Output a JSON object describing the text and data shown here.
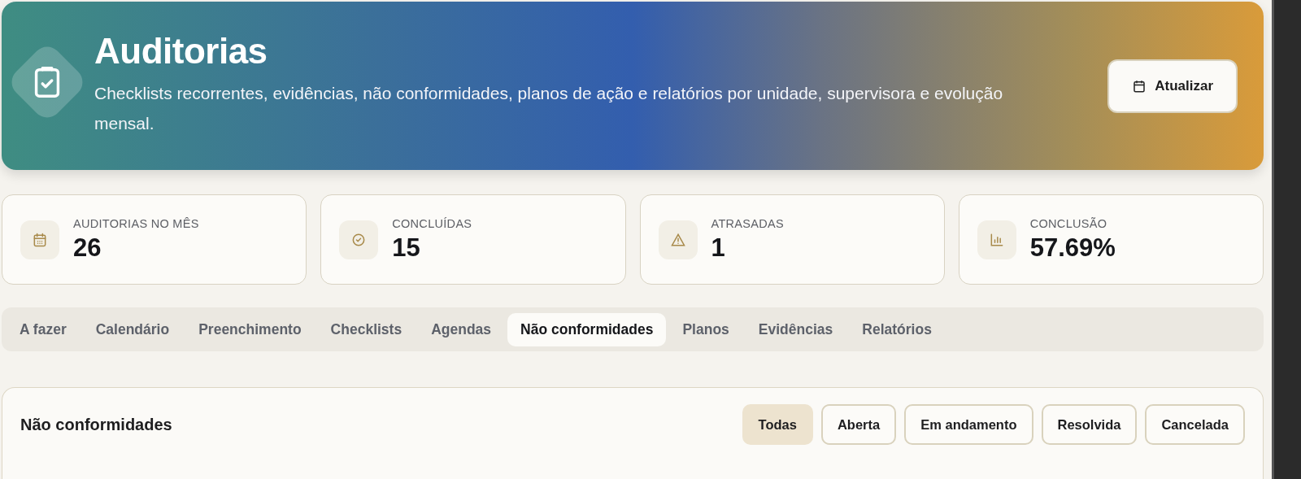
{
  "header": {
    "title": "Auditorias",
    "subtitle": "Checklists recorrentes, evidências, não conformidades, planos de ação e relatórios por unidade, supervisora e evolução mensal.",
    "button": "Atualizar"
  },
  "stats": [
    {
      "kind": "calendar",
      "label": "AUDITORIAS NO MÊS",
      "value": "26"
    },
    {
      "kind": "check",
      "label": "CONCLUÍDAS",
      "value": "15"
    },
    {
      "kind": "warning",
      "label": "ATRASADAS",
      "value": "1"
    },
    {
      "kind": "chart",
      "label": "CONCLUSÃO",
      "value": "57.69%"
    }
  ],
  "tabs": [
    {
      "label": "A fazer",
      "selected": false
    },
    {
      "label": "Calendário",
      "selected": false
    },
    {
      "label": "Preenchimento",
      "selected": false
    },
    {
      "label": "Checklists",
      "selected": false
    },
    {
      "label": "Agendas",
      "selected": false
    },
    {
      "label": "Não conformidades",
      "selected": true
    },
    {
      "label": "Planos",
      "selected": false
    },
    {
      "label": "Evidências",
      "selected": false
    },
    {
      "label": "Relatórios",
      "selected": false
    }
  ],
  "panel": {
    "title": "Não conformidades",
    "filters": [
      {
        "label": "Todas",
        "selected": true
      },
      {
        "label": "Aberta",
        "selected": false
      },
      {
        "label": "Em andamento",
        "selected": false
      },
      {
        "label": "Resolvida",
        "selected": false
      },
      {
        "label": "Cancelada",
        "selected": false
      }
    ]
  }
}
